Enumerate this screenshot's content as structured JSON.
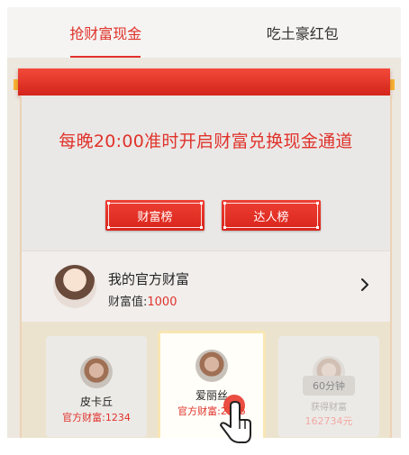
{
  "tabs": [
    {
      "label": "抢财富现金",
      "active": true
    },
    {
      "label": "吃土豪红包",
      "active": false
    }
  ],
  "notice": {
    "text": "每晚20:00准时开启财富兑换现金通道",
    "buttons": [
      "财富榜",
      "达人榜"
    ]
  },
  "mine": {
    "title": "我的官方财富",
    "value_label": "财富值:",
    "value": "1000"
  },
  "cards": [
    {
      "name": "皮卡丘",
      "wealth": "官方财富:1234"
    },
    {
      "name": "爱丽丝",
      "wealth": "官方财富:2345"
    },
    {
      "badge": "60分钟",
      "sub": "获得财富",
      "amount": "162734元"
    }
  ],
  "colors": {
    "accent": "#e0322b",
    "gold": "#f6b334"
  },
  "icons": {
    "chevron": "chevron-right-icon",
    "hand": "hand-pointer-icon"
  }
}
